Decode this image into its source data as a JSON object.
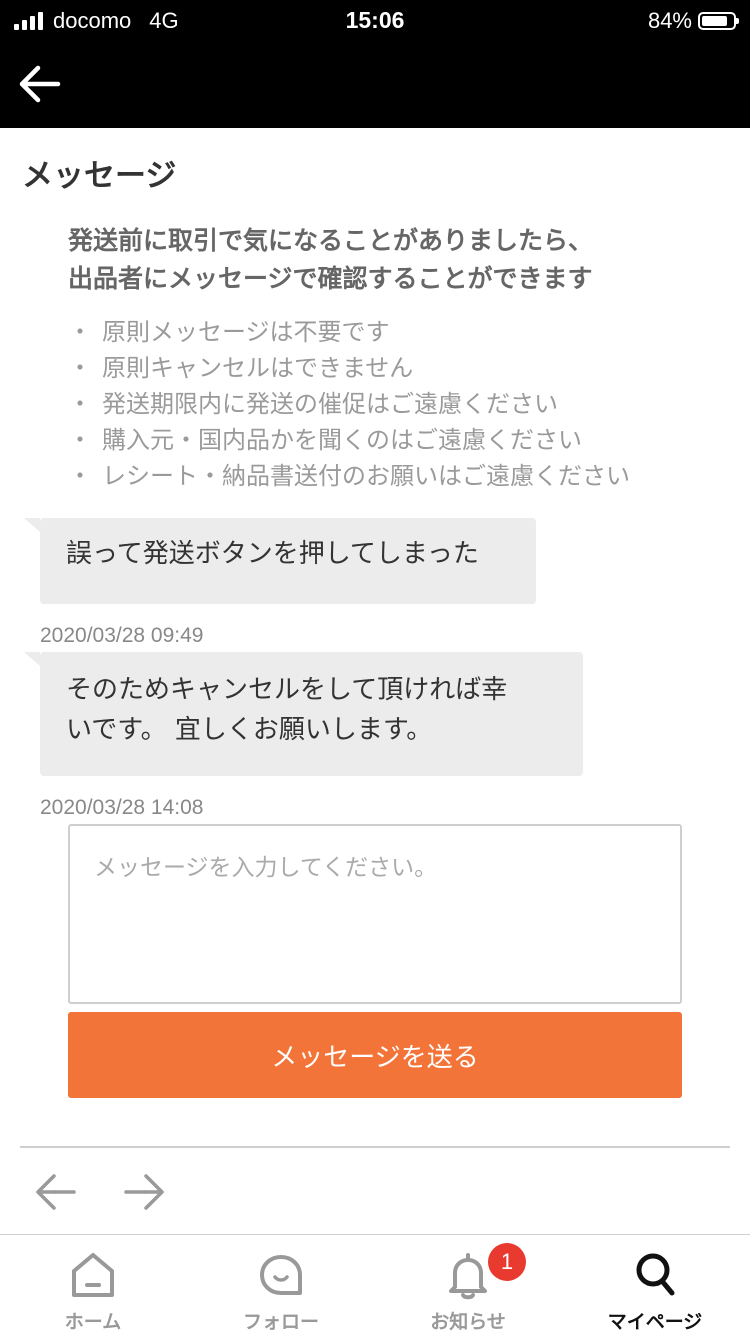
{
  "status_bar": {
    "carrier": "docomo",
    "network": "4G",
    "time": "15:06",
    "battery_percent": "84%",
    "battery_level": 0.84
  },
  "nav": {
    "back_icon": "arrow-left-icon"
  },
  "page": {
    "title": "メッセージ"
  },
  "notice": {
    "heading_line1": "発送前に取引で気になることがありましたら、",
    "heading_line2": "出品者にメッセージで確認することができます",
    "rules": [
      "原則メッセージは不要です",
      "原則キャンセルはできません",
      "発送期限内に発送の催促はご遠慮ください",
      "購入元・国内品かを聞くのはご遠慮ください",
      "レシート・納品書送付のお願いはご遠慮ください"
    ]
  },
  "messages": [
    {
      "line1": "誤って発送ボタンを押してしまった",
      "line2": "",
      "timestamp": "2020/03/28 09:49"
    },
    {
      "line1": "そのためキャンセルをして頂ければ幸",
      "line2": "いです。 宜しくお願いします。",
      "timestamp": "2020/03/28 14:08"
    }
  ],
  "compose": {
    "placeholder": "メッセージを入力してください。",
    "send_label": "メッセージを送る",
    "send_color": "#f37439"
  },
  "tabs": [
    {
      "label": "ホーム",
      "icon": "home-icon"
    },
    {
      "label": "フォロー",
      "icon": "follow-icon"
    },
    {
      "label": "お知らせ",
      "icon": "bell-icon",
      "badge": "1"
    },
    {
      "label": "マイページ",
      "icon": "search-icon",
      "active": true
    }
  ]
}
